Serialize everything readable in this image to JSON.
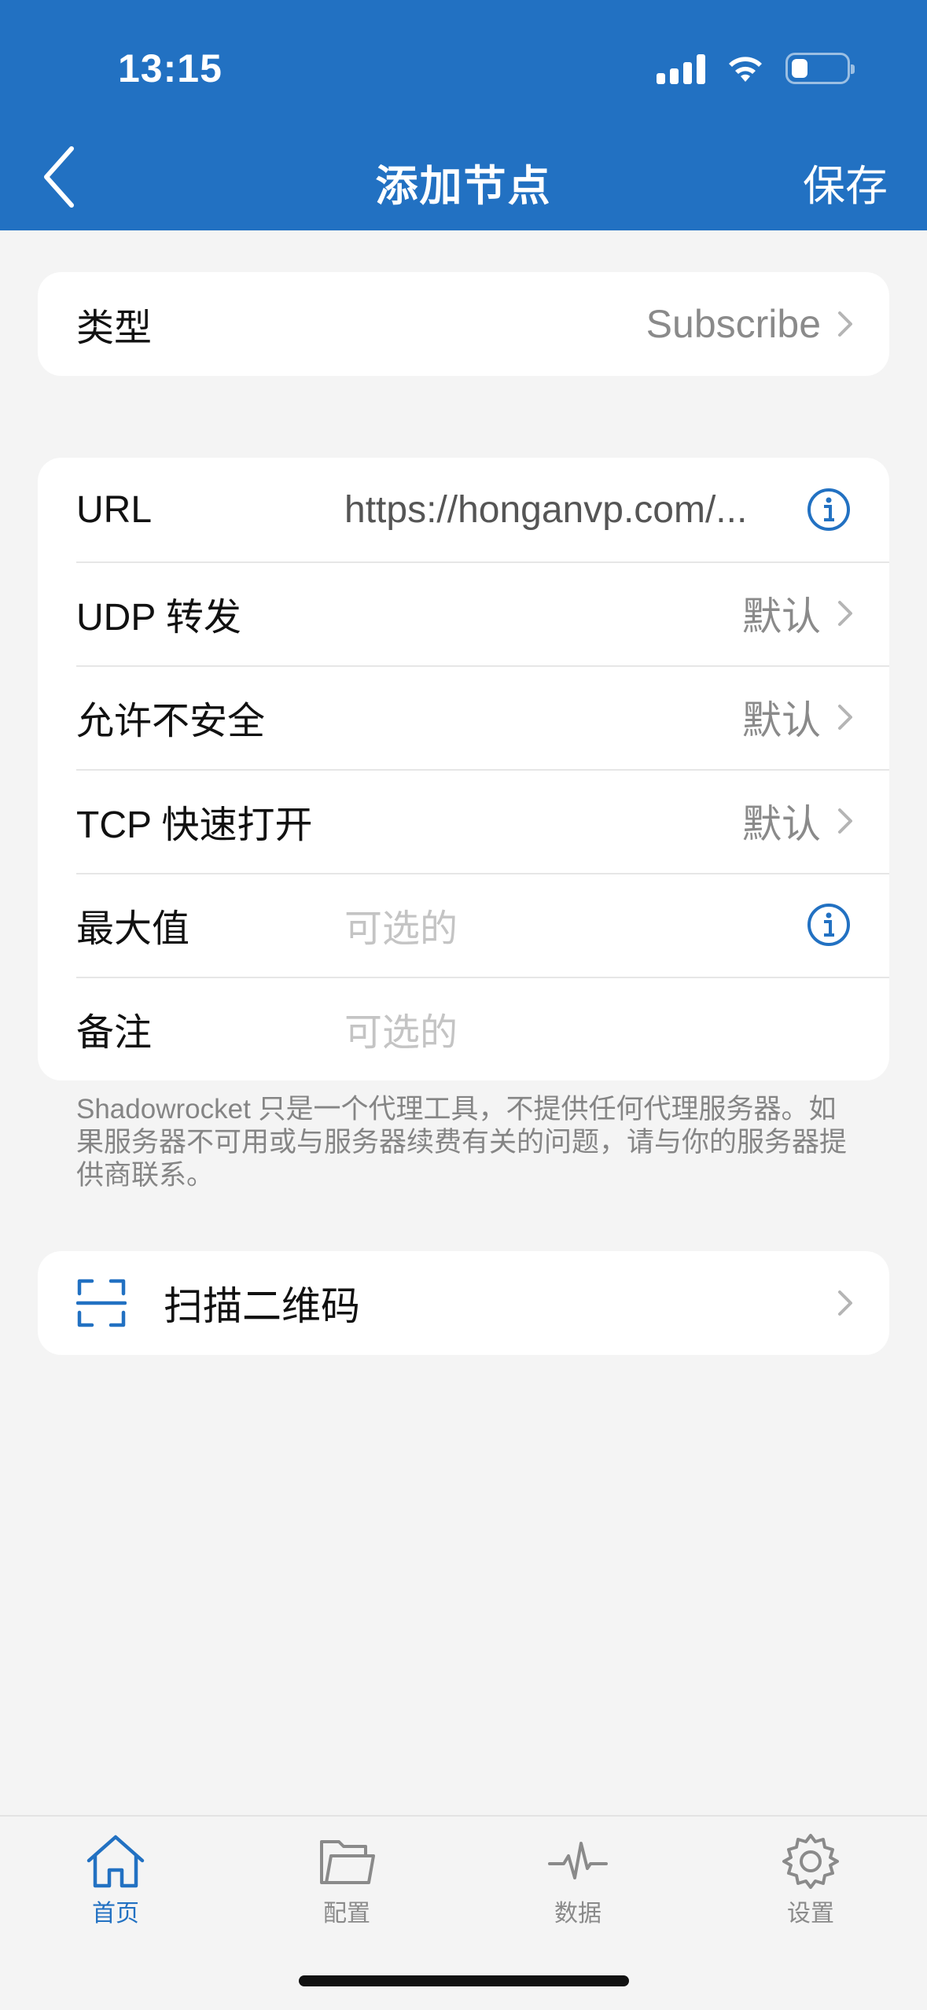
{
  "status_bar": {
    "time": "13:15"
  },
  "nav": {
    "title": "添加节点",
    "save_label": "保存"
  },
  "type_row": {
    "label": "类型",
    "value": "Subscribe"
  },
  "settings": {
    "url": {
      "label": "URL",
      "value": "https://honganvp.com/..."
    },
    "udp": {
      "label": "UDP 转发",
      "value": "默认"
    },
    "insecure": {
      "label": "允许不安全",
      "value": "默认"
    },
    "tcp_fast_open": {
      "label": "TCP 快速打开",
      "value": "默认"
    },
    "max": {
      "label": "最大值",
      "placeholder": "可选的"
    },
    "remark": {
      "label": "备注",
      "placeholder": "可选的"
    }
  },
  "footnote": "Shadowrocket 只是一个代理工具，不提供任何代理服务器。如果服务器不可用或与服务器续费有关的问题，请与你的服务器提供商联系。",
  "scan": {
    "label": "扫描二维码"
  },
  "tabs": [
    {
      "label": "首页",
      "icon": "home-icon",
      "active": true
    },
    {
      "label": "配置",
      "icon": "folder-icon",
      "active": false
    },
    {
      "label": "数据",
      "icon": "activity-icon",
      "active": false
    },
    {
      "label": "设置",
      "icon": "gear-icon",
      "active": false
    }
  ],
  "colors": {
    "brand": "#2271c2",
    "background": "#f4f4f4",
    "secondary_text": "#8a8a8a"
  }
}
